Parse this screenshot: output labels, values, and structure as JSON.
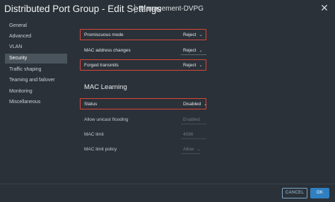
{
  "header": {
    "title": "Distributed Port Group - Edit Settings",
    "subtitle": "Management-DVPG",
    "close_icon": "close-icon"
  },
  "sidebar": {
    "items": [
      {
        "label": "General"
      },
      {
        "label": "Advanced"
      },
      {
        "label": "VLAN"
      },
      {
        "label": "Security",
        "active": true
      },
      {
        "label": "Traffic shaping"
      },
      {
        "label": "Teaming and failover"
      },
      {
        "label": "Monitoring"
      },
      {
        "label": "Miscellaneous"
      }
    ]
  },
  "security": {
    "promiscuous_mode": {
      "label": "Promiscuous mode",
      "value": "Reject"
    },
    "mac_address_changes": {
      "label": "MAC address changes",
      "value": "Reject"
    },
    "forged_transmits": {
      "label": "Forged transmits",
      "value": "Reject"
    }
  },
  "mac_learning": {
    "title": "MAC Learning",
    "status": {
      "label": "Status",
      "value": "Disabled"
    },
    "allow_unicast_flooding": {
      "label": "Allow unicast flooding",
      "value": "Enabled"
    },
    "mac_limit": {
      "label": "MAC limit",
      "value": "4096"
    },
    "mac_limit_policy": {
      "label": "MAC limit policy",
      "value": "Allow"
    }
  },
  "footer": {
    "cancel_label": "CANCEL",
    "ok_label": "OK"
  },
  "colors": {
    "background": "#2a3138",
    "highlight": "#d9473c",
    "primary_button": "#2f7fc1",
    "sidebar_active": "#4a545d"
  }
}
